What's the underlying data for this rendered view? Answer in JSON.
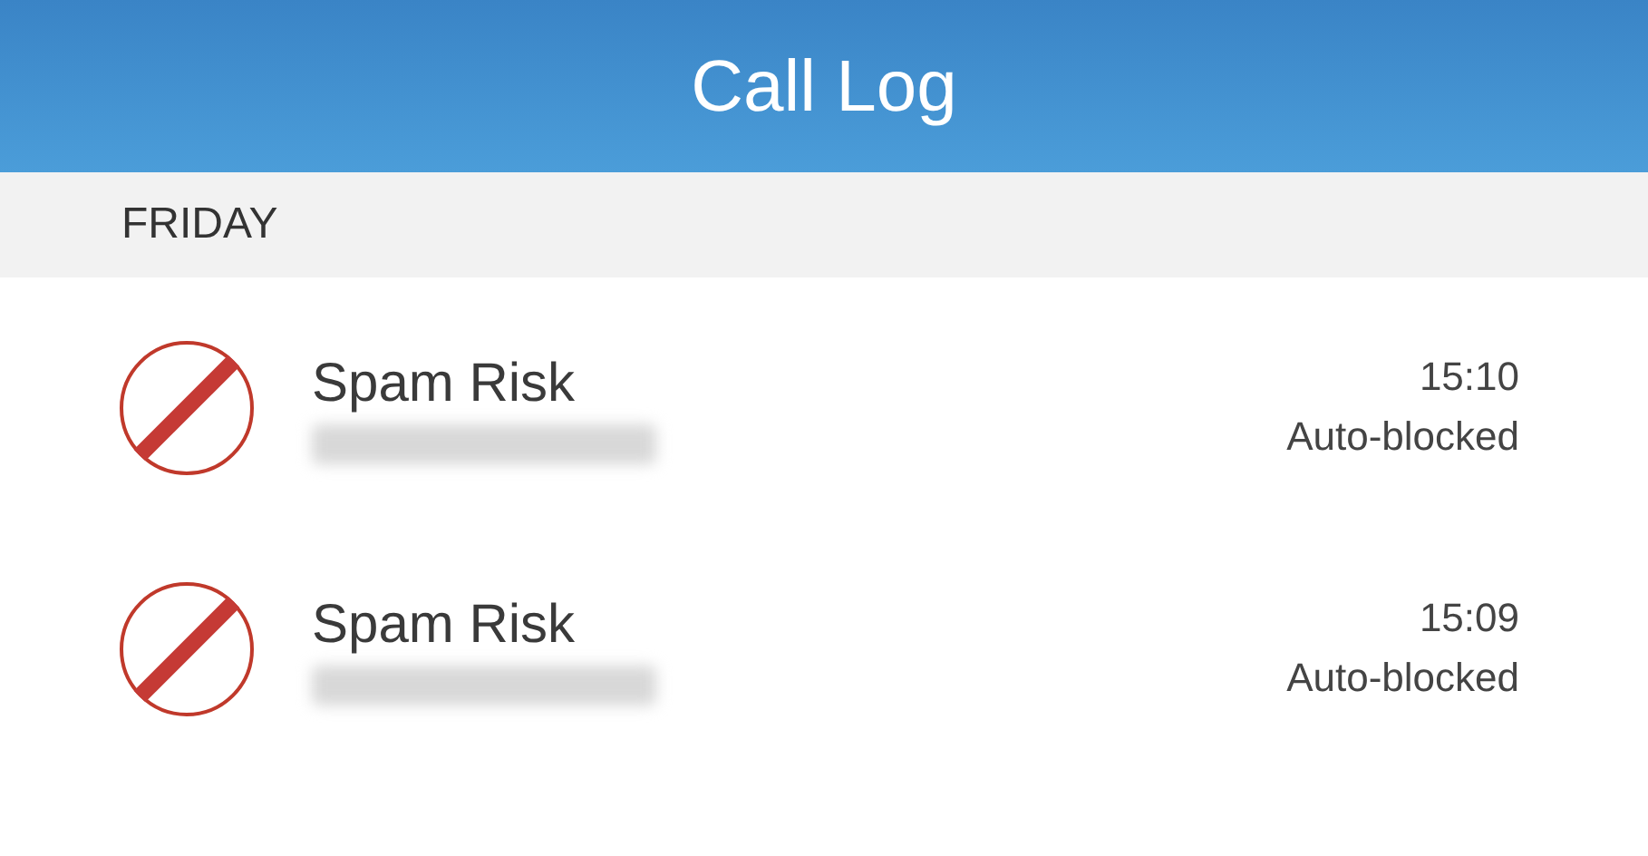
{
  "header": {
    "title": "Call Log"
  },
  "sections": [
    {
      "label": "FRIDAY",
      "calls": [
        {
          "kind": "blocked",
          "name": "Spam Risk",
          "time": "15:10",
          "status": "Auto-blocked"
        },
        {
          "kind": "blocked",
          "name": "Spam Risk",
          "time": "15:09",
          "status": "Auto-blocked"
        }
      ]
    }
  ]
}
